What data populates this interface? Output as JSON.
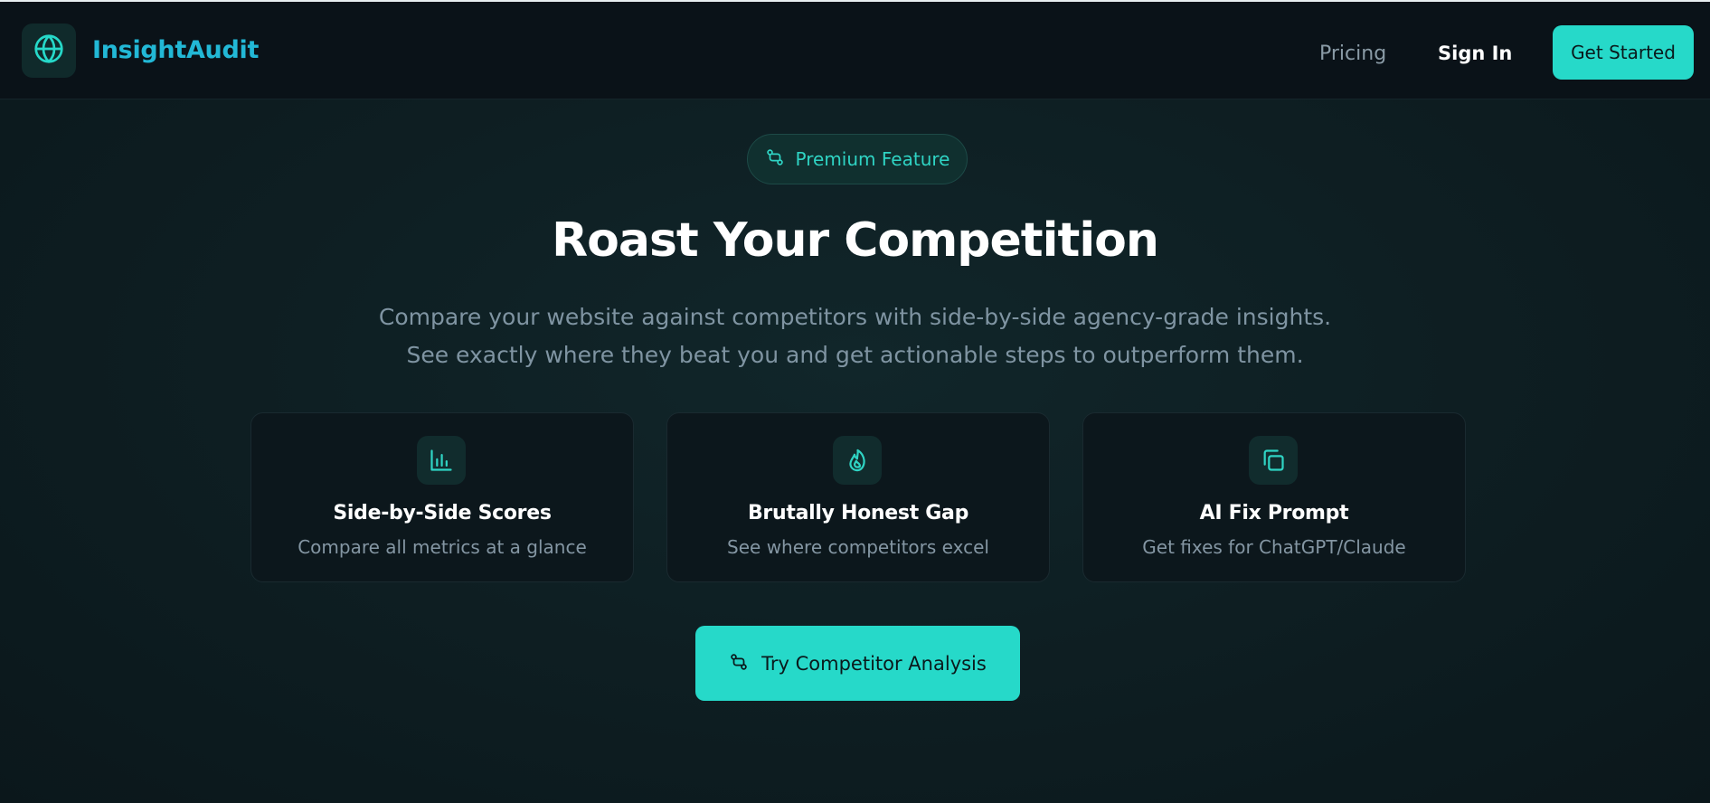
{
  "colors": {
    "accent": "#26d9c9",
    "brand": "#22b8d6",
    "background": "#0d1b20",
    "header_bg": "#0a1218",
    "muted_text": "#7f94a2"
  },
  "header": {
    "brand_name": "InsightAudit",
    "logo_icon": "globe-icon",
    "nav": {
      "pricing": "Pricing",
      "sign_in": "Sign In",
      "get_started": "Get Started"
    }
  },
  "badge": {
    "icon": "git-compare-icon",
    "label": "Premium Feature"
  },
  "hero": {
    "title": "Roast Your Competition",
    "subtitle_line1": "Compare your website against competitors with side-by-side agency-grade insights.",
    "subtitle_line2": "See exactly where they beat you and get actionable steps to outperform them."
  },
  "features": [
    {
      "icon": "bar-chart-icon",
      "title": "Side-by-Side Scores",
      "description": "Compare all metrics at a glance"
    },
    {
      "icon": "flame-icon",
      "title": "Brutally Honest Gap",
      "description": "See where competitors excel"
    },
    {
      "icon": "copy-icon",
      "title": "AI Fix Prompt",
      "description": "Get fixes for ChatGPT/Claude"
    }
  ],
  "cta": {
    "icon": "git-compare-icon",
    "label": "Try Competitor Analysis"
  }
}
